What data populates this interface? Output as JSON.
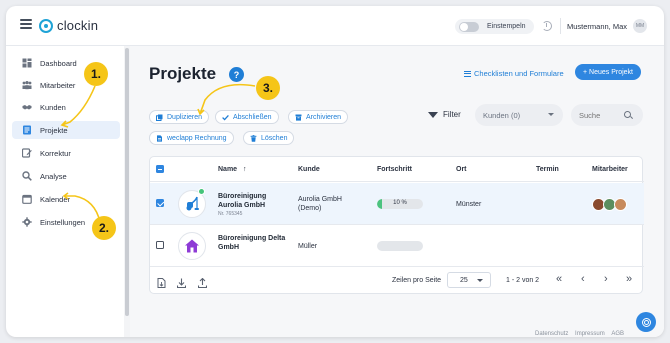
{
  "app": {
    "name": "clockin"
  },
  "topbar": {
    "stamp_label": "Einstempeln",
    "user_name": "Mustermann, Max",
    "user_initials": "MM"
  },
  "sidebar": {
    "items": [
      {
        "label": "Dashboard",
        "icon": "dashboard-icon"
      },
      {
        "label": "Mitarbeiter",
        "icon": "users-icon"
      },
      {
        "label": "Kunden",
        "icon": "handshake-icon"
      },
      {
        "label": "Projekte",
        "icon": "projects-icon",
        "active": true
      },
      {
        "label": "Korrektur",
        "icon": "edit-icon"
      },
      {
        "label": "Analyse",
        "icon": "search-icon"
      },
      {
        "label": "Kalender",
        "icon": "calendar-icon"
      },
      {
        "label": "Einstellungen",
        "icon": "gear-icon"
      }
    ]
  },
  "page": {
    "title": "Projekte",
    "help": "?",
    "checklists_link": "Checklisten und Formulare",
    "new_project": "+ Neues Projekt"
  },
  "actions": {
    "duplicate": "Duplizieren",
    "complete": "Abschließen",
    "archive": "Archivieren",
    "invoice": "weclapp Rechnung",
    "delete": "Löschen"
  },
  "filters": {
    "filter_label": "Filter",
    "customers_select": "Kunden (0)",
    "search_placeholder": "Suche"
  },
  "table": {
    "headers": {
      "name": "Name",
      "sort_arrow": "↑",
      "customer": "Kunde",
      "progress": "Fortschritt",
      "location": "Ort",
      "date": "Termin",
      "staff": "Mitarbeiter"
    },
    "rows": [
      {
        "selected": true,
        "name": "Büroreinigung Aurolia GmbH",
        "number": "Nr. 765345",
        "customer": "Aurolia GmbH (Demo)",
        "progress_label": "10 %",
        "progress": 0.1,
        "location": "Münster",
        "icon": "vacuum-icon",
        "icon_color": "#1f7ed6",
        "staff_colors": [
          "#8a4a2e",
          "#5b8e5f",
          "#c78a5c"
        ]
      },
      {
        "selected": false,
        "name": "Büroreinigung Delta GmbH",
        "number": "",
        "customer": "Müller",
        "progress_label": "",
        "progress": 0,
        "location": "",
        "icon": "house-icon",
        "icon_color": "#8e3bd6",
        "staff_colors": []
      }
    ],
    "footer": {
      "rows_per_page_label": "Zeilen pro Seite",
      "rows_per_page": "25",
      "range": "1 - 2 von 2",
      "first": "«",
      "prev": "‹",
      "next": "›",
      "last": "»"
    }
  },
  "footer_links": {
    "privacy": "Datenschutz",
    "imprint": "Impressum",
    "terms": "AGB"
  },
  "annotations": [
    "1.",
    "2.",
    "3."
  ],
  "colors": {
    "accent": "#2e86e0",
    "annotation": "#f5c518",
    "progress": "#4cc37f"
  }
}
